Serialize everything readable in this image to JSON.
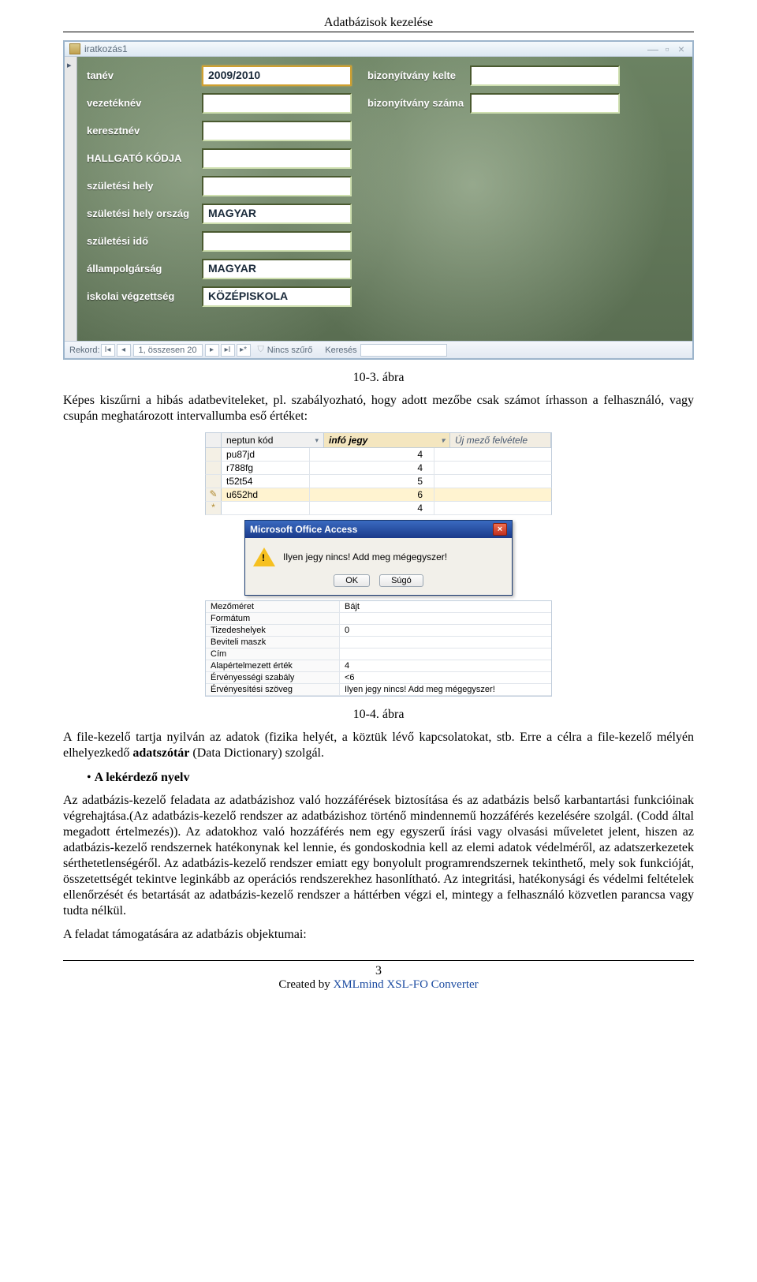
{
  "header": {
    "title": "Adatbázisok kezelése"
  },
  "form_window": {
    "tab_title": "iratkozás1",
    "fields": {
      "tanev": {
        "label": "tanév",
        "value": "2009/2010"
      },
      "vezeteknev": {
        "label": "vezetéknév",
        "value": ""
      },
      "keresztnev": {
        "label": "keresztnév",
        "value": ""
      },
      "hallgato_kodja": {
        "label": "HALLGATÓ KÓDJA",
        "value": ""
      },
      "szuletesi_hely": {
        "label": "születési hely",
        "value": ""
      },
      "szuletesi_hely_orszag": {
        "label": "születési hely ország",
        "value": "MAGYAR"
      },
      "szuletesi_ido": {
        "label": "születési idő",
        "value": ""
      },
      "allampolgarsag": {
        "label": "állampolgárság",
        "value": "MAGYAR"
      },
      "iskolai_vegzettseg": {
        "label": "iskolai végzettség",
        "value": "KÖZÉPISKOLA"
      },
      "bizonyitvany_kelte": {
        "label": "bizonyítvány kelte",
        "value": ""
      },
      "bizonyitvany_szama": {
        "label": "bizonyítvány száma",
        "value": ""
      }
    },
    "recordbar": {
      "label": "Rekord:",
      "position": "1, összesen 20",
      "no_filter": "Nincs szűrő",
      "search_label": "Keresés"
    }
  },
  "captions": {
    "fig1": "10-3. ábra",
    "fig2": "10-4. ábra"
  },
  "para1": "Képes kiszűrni a hibás adatbeviteleket, pl. szabályozható, hogy adott mezőbe csak számot írhasson a felhasználó, vagy csupán meghatározott intervallumba eső értéket:",
  "datasheet": {
    "headers": {
      "col1": "neptun kód",
      "col2": "infó jegy",
      "col3": "Új mező felvétele"
    },
    "rows": [
      {
        "marker": "",
        "col1": "pu87jd",
        "col2": "4"
      },
      {
        "marker": "",
        "col1": "r788fg",
        "col2": "4"
      },
      {
        "marker": "",
        "col1": "t52t54",
        "col2": "5"
      },
      {
        "marker": "✎",
        "col1": "u652hd",
        "col2": "6",
        "selected": true
      },
      {
        "marker": "*",
        "col1": "",
        "col2": "4"
      }
    ]
  },
  "msgbox": {
    "title": "Microsoft Office Access",
    "text": "Ilyen jegy nincs! Add meg mégegyszer!",
    "ok": "OK",
    "help": "Súgó"
  },
  "props": [
    {
      "k": "Mezőméret",
      "v": "Bájt"
    },
    {
      "k": "Formátum",
      "v": ""
    },
    {
      "k": "Tizedeshelyek",
      "v": "0"
    },
    {
      "k": "Beviteli maszk",
      "v": ""
    },
    {
      "k": "Cím",
      "v": ""
    },
    {
      "k": "Alapértelmezett érték",
      "v": "4"
    },
    {
      "k": "Érvényességi szabály",
      "v": "<6"
    },
    {
      "k": "Érvényesítési szöveg",
      "v": "Ilyen jegy nincs! Add meg mégegyszer!"
    }
  ],
  "para2": "A file-kezelő tartja nyilván az adatok (fizika helyét, a köztük lévő kapcsolatokat, stb. Erre a célra a file-kezelő mélyén elhelyezkedő adatszótár (Data Dictionary) szolgál.",
  "bullet_heading": "A lekérdező nyelv",
  "para3": "Az adatbázis-kezelő feladata az adatbázishoz való hozzáférések biztosítása és az adatbázis belső karbantartási funkcióinak végrehajtása.(Az adatbázis-kezelő rendszer az adatbázishoz történő mindennemű hozzáférés kezelésére szolgál. (Codd által megadott értelmezés)). Az adatokhoz való hozzáférés nem egy egyszerű írási vagy olvasási műveletet jelent, hiszen az adatbázis-kezelő rendszernek hatékonynak kel lennie, és gondoskodnia kell az elemi adatok védelméről, az adatszerkezetek sérthetetlenségéről. Az adatbázis-kezelő rendszer emiatt egy bonyolult programrendszernek tekinthető, mely sok funkcióját, összetettségét tekintve leginkább az operációs rendszerekhez hasonlítható. Az integritási, hatékonysági és védelmi feltételek ellenőrzését és betartását az adatbázis-kezelő rendszer a háttérben végzi el, mintegy a felhasználó közvetlen parancsa vagy tudta nélkül.",
  "para4": "A feladat támogatására az adatbázis objektumai:",
  "footer": {
    "page": "3",
    "credit_prefix": "Created by ",
    "credit_link": "XMLmind XSL-FO Converter"
  }
}
